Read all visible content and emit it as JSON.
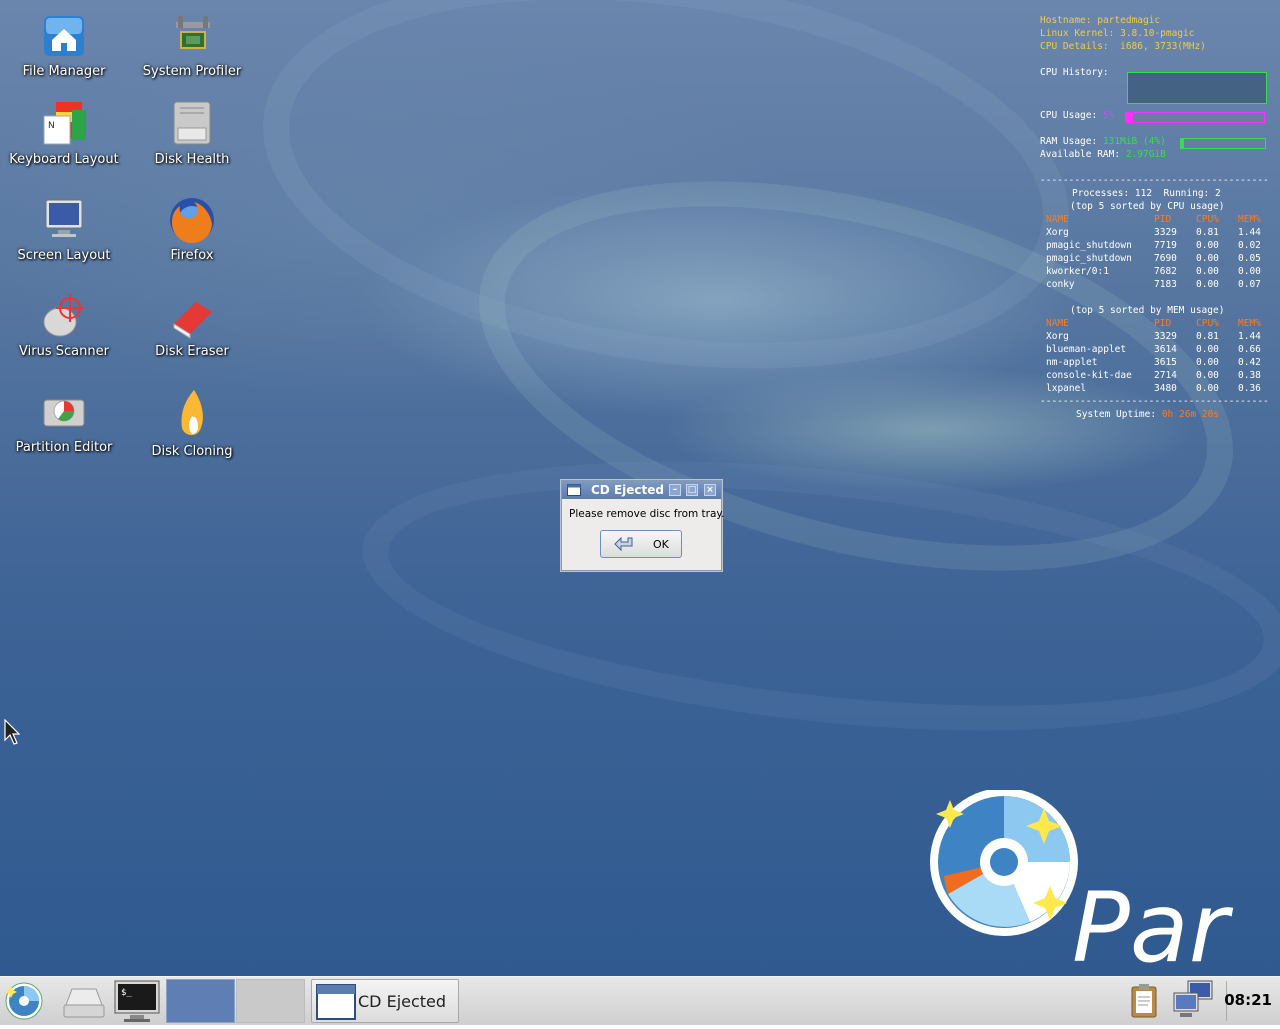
{
  "desktop_icons": [
    {
      "label": "File Manager",
      "icon": "home-folder-icon"
    },
    {
      "label": "System Profiler",
      "icon": "caliper-chip-icon"
    },
    {
      "label": "Keyboard Layout",
      "icon": "keyboard-flags-icon"
    },
    {
      "label": "Disk Health",
      "icon": "hard-disk-icon"
    },
    {
      "label": "Screen Layout",
      "icon": "monitor-icon"
    },
    {
      "label": "Firefox",
      "icon": "firefox-icon"
    },
    {
      "label": "Virus Scanner",
      "icon": "virus-target-icon"
    },
    {
      "label": "Disk Eraser",
      "icon": "eraser-icon"
    },
    {
      "label": "Partition Editor",
      "icon": "partition-disk-icon"
    },
    {
      "label": "Disk Cloning",
      "icon": "clone-sheep-icon"
    }
  ],
  "conky": {
    "hostname_label": "Hostname:",
    "hostname": "partedmagic",
    "kernel_label": "Linux Kernel:",
    "kernel": "3.8.10-pmagic",
    "cpu_details_label": "CPU Details:",
    "cpu_details": "i686, 3733(MHz)",
    "cpu_history_label": "CPU History:",
    "cpu_usage_label": "CPU Usage:",
    "cpu_usage": "5%",
    "cpu_usage_fraction": 0.05,
    "ram_usage_label": "RAM Usage:",
    "ram_usage": "131MiB (4%)",
    "ram_usage_fraction": 0.04,
    "available_ram_label": "Available RAM:",
    "available_ram": "2.97GiB",
    "separator": "----------------------------------------",
    "processes_line": "Processes: 112  Running: 2",
    "cpu_sorted_title": "(top 5 sorted by CPU usage)",
    "mem_sorted_title": "(top 5 sorted by MEM usage)",
    "columns": [
      "NAME",
      "PID",
      "CPU%",
      "MEM%"
    ],
    "top_cpu": [
      {
        "name": "Xorg",
        "pid": "3329",
        "cpu": "0.81",
        "mem": "1.44"
      },
      {
        "name": "pmagic_shutdown",
        "pid": "7719",
        "cpu": "0.00",
        "mem": "0.02"
      },
      {
        "name": "pmagic_shutdown",
        "pid": "7690",
        "cpu": "0.00",
        "mem": "0.05"
      },
      {
        "name": "kworker/0:1",
        "pid": "7682",
        "cpu": "0.00",
        "mem": "0.00"
      },
      {
        "name": "conky",
        "pid": "7183",
        "cpu": "0.00",
        "mem": "0.07"
      }
    ],
    "top_mem": [
      {
        "name": "Xorg",
        "pid": "3329",
        "cpu": "0.81",
        "mem": "1.44"
      },
      {
        "name": "blueman-applet",
        "pid": "3614",
        "cpu": "0.00",
        "mem": "0.66"
      },
      {
        "name": "nm-applet",
        "pid": "3615",
        "cpu": "0.00",
        "mem": "0.42"
      },
      {
        "name": "console-kit-dae",
        "pid": "2714",
        "cpu": "0.00",
        "mem": "0.38"
      },
      {
        "name": "lxpanel",
        "pid": "3480",
        "cpu": "0.00",
        "mem": "0.36"
      }
    ],
    "uptime_label": "System Uptime:",
    "uptime": "0h 26m 20s"
  },
  "dialog": {
    "title": "CD Ejected",
    "message": "Please remove disc from tray.",
    "ok_label": "OK"
  },
  "taskbar": {
    "window_button_label": "CD Ejected",
    "clock": "08:21"
  },
  "wallpaper": {
    "brand_text": "Par"
  },
  "colors": {
    "conky_yellow": "#f2c94c",
    "conky_orange": "#ff7a1a",
    "conky_green": "#33e04a",
    "conky_magenta": "#ff30ff",
    "title_blue": "#5c7cae"
  }
}
